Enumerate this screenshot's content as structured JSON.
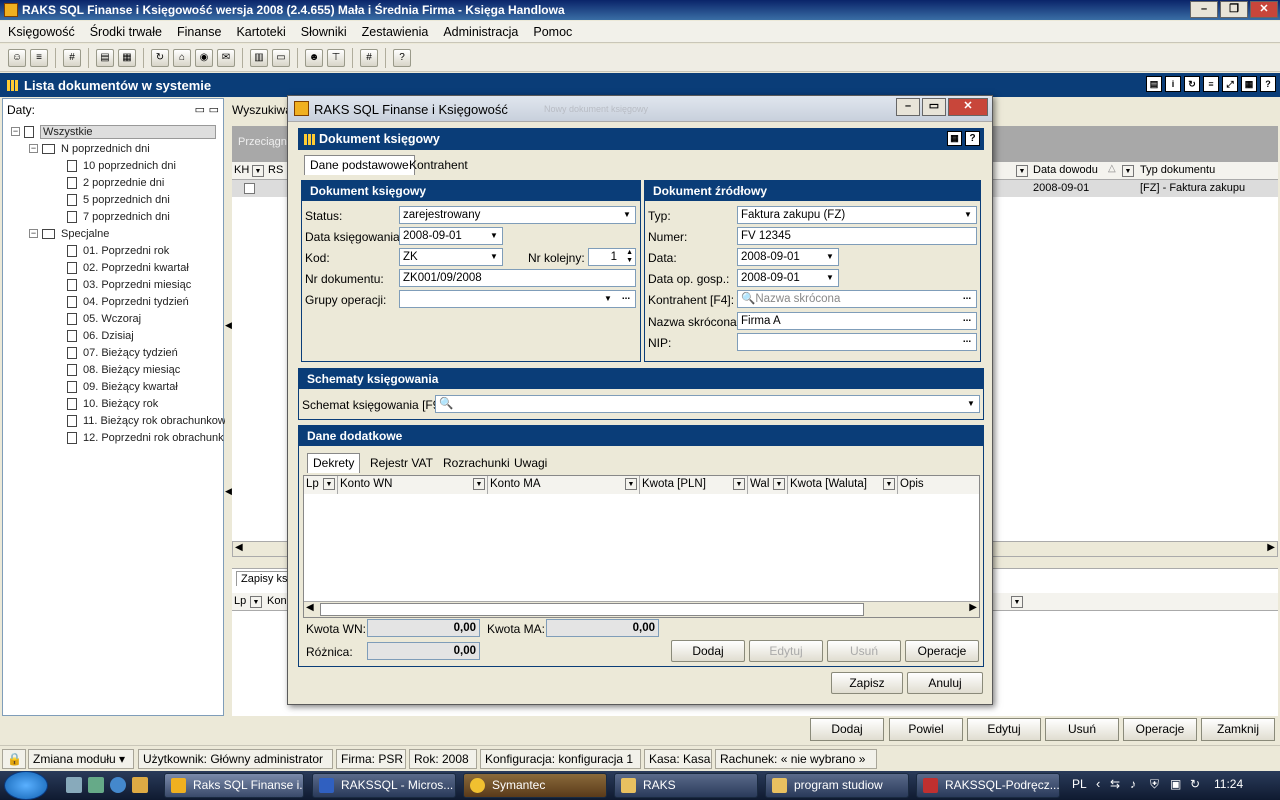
{
  "app": {
    "title": "RAKS SQL Finanse i Księgowość wersja 2008 (2.4.655) Mała i Średnia Firma - Księga Handlowa"
  },
  "menu": [
    "Księgowość",
    "Środki trwałe",
    "Finanse",
    "Kartoteki",
    "Słowniki",
    "Zestawienia",
    "Administracja",
    "Pomoc"
  ],
  "panel": {
    "title": "Lista dokumentów w systemie"
  },
  "left": {
    "label": "Daty:",
    "tree": {
      "root": "Wszystkie",
      "group1": "N poprzednich dni",
      "group1_items": [
        "10 poprzednich dni",
        "2 poprzednie dni",
        "5 poprzednich dni",
        "7 poprzednich dni"
      ],
      "group2": "Specjalne",
      "group2_items": [
        "01. Poprzedni rok",
        "02. Poprzedni kwartał",
        "03. Poprzedni miesiąc",
        "04. Poprzedni tydzień",
        "05. Wczoraj",
        "06. Dzisiaj",
        "07. Bieżący tydzień",
        "08. Bieżący miesiąc",
        "09. Bieżący kwartał",
        "10. Bieżący rok",
        "11. Bieżący rok obrachunkow",
        "12. Poprzedni rok obrachunk"
      ]
    }
  },
  "right": {
    "search_label": "Wyszukiwar",
    "drag_hint": "Przeciągn",
    "cols": {
      "kh": "KH",
      "rs": "RS",
      "data_dowodu": "Data dowodu",
      "typ": "Typ dokumentu"
    },
    "row": {
      "data": "2008-09-01",
      "typ": "[FZ] - Faktura zakupu"
    },
    "bottom_tab": "Zapisy ksi",
    "bottom_cols": {
      "lp": "Lp",
      "kon": "Kon"
    }
  },
  "dialog": {
    "title": "RAKS SQL Finanse i Księgowość",
    "header": "Dokument księgowy",
    "tabs": [
      "Dane podstawowe",
      "Kontrahent"
    ],
    "doc": {
      "head": "Dokument księgowy",
      "status_label": "Status:",
      "status": "zarejestrowany",
      "date_label": "Data księgowania:",
      "date": "2008-09-01",
      "kod_label": "Kod:",
      "kod": "ZK",
      "nr_kolejny_label": "Nr kolejny:",
      "nr_kolejny": "1",
      "nr_label": "Nr dokumentu:",
      "nr": "ZK001/09/2008",
      "grupy_label": "Grupy operacji:"
    },
    "src": {
      "head": "Dokument źródłowy",
      "typ_label": "Typ:",
      "typ": "Faktura zakupu (FZ)",
      "numer_label": "Numer:",
      "numer": "FV 12345",
      "data_label": "Data:",
      "data": "2008-09-01",
      "dataop_label": "Data op. gosp.:",
      "dataop": "2008-09-01",
      "kontrahent_label": "Kontrahent [F4]:",
      "kontrahent_placeholder": "Nazwa skrócona",
      "nazwa_label": "Nazwa skrócona:",
      "nazwa": "Firma A",
      "nip_label": "NIP:"
    },
    "schemat": {
      "head": "Schematy księgowania",
      "label": "Schemat księgowania [F9]:"
    },
    "extra": {
      "head": "Dane dodatkowe",
      "tabs": [
        "Dekrety",
        "Rejestr VAT",
        "Rozrachunki",
        "Uwagi"
      ],
      "cols": [
        "Lp",
        "Konto WN",
        "Konto MA",
        "Kwota [PLN]",
        "Wal",
        "Kwota [Waluta]",
        "Opis"
      ],
      "kwota_wn_label": "Kwota WN:",
      "kwota_wn": "0,00",
      "kwota_ma_label": "Kwota MA:",
      "kwota_ma": "0,00",
      "roznica_label": "Różnica:",
      "roznica": "0,00",
      "btn_dodaj": "Dodaj",
      "btn_edytuj": "Edytuj",
      "btn_usun": "Usuń",
      "btn_operacje": "Operacje"
    },
    "btn_zapisz": "Zapisz",
    "btn_anuluj": "Anuluj",
    "behind_title": "Nowy dokument księgowy"
  },
  "bottom_buttons": [
    "Dodaj",
    "Powiel",
    "Edytuj",
    "Usuń",
    "Operacje",
    "Zamknij"
  ],
  "status": {
    "modul": "Zmiana modułu",
    "user": "Użytkownik: Główny administrator",
    "firma": "Firma: PSR",
    "rok": "Rok: 2008",
    "konf": "Konfiguracja: konfiguracja 1",
    "kasa": "Kasa: Kasa",
    "rach": "Rachunek: « nie wybrano »"
  },
  "taskbar": {
    "tasks": [
      "Raks SQL Finanse i...",
      "RAKSSQL - Micros...",
      "Symantec",
      "RAKS",
      "program studiow",
      "RAKSSQL-Podręcz..."
    ],
    "lang": "PL",
    "time": "11:24"
  }
}
